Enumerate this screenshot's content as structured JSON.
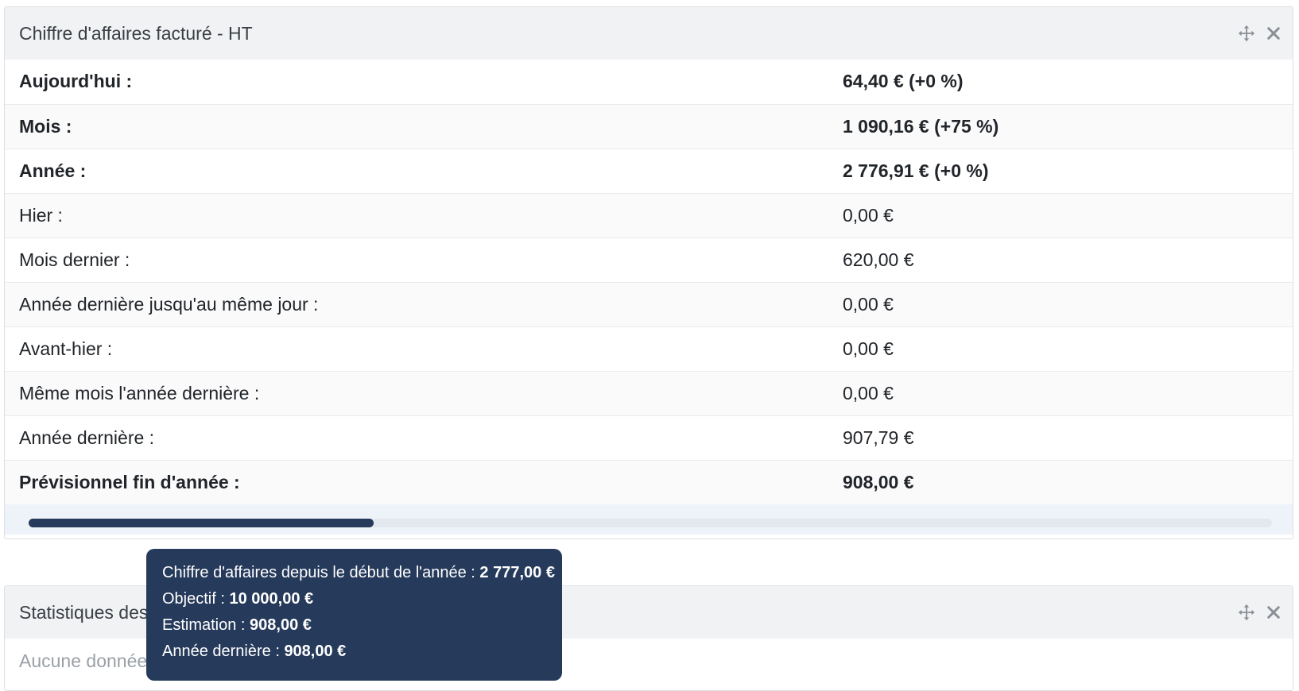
{
  "panel1": {
    "title": "Chiffre d'affaires facturé - HT",
    "tools": {
      "move_icon": "move-arrows-icon",
      "close_icon": "close-icon"
    },
    "rows": [
      {
        "label": "Aujourd'hui :",
        "value": "64,40 € (+0 %)",
        "bold": true
      },
      {
        "label": "Mois :",
        "value": "1 090,16 € (+75 %)",
        "bold": true
      },
      {
        "label": "Année :",
        "value": "2 776,91 € (+0 %)",
        "bold": true
      },
      {
        "label": "Hier :",
        "value": "0,00 €",
        "bold": false
      },
      {
        "label": "Mois dernier :",
        "value": "620,00 €",
        "bold": false
      },
      {
        "label": "Année dernière jusqu'au même jour :",
        "value": "0,00 €",
        "bold": false
      },
      {
        "label": "Avant-hier :",
        "value": "0,00 €",
        "bold": false
      },
      {
        "label": "Même mois l'année dernière :",
        "value": "0,00 €",
        "bold": false
      },
      {
        "label": "Année dernière :",
        "value": "907,79 €",
        "bold": false
      },
      {
        "label": "Prévisionnel fin d'année :",
        "value": "908,00 €",
        "bold": true
      }
    ],
    "progress": {
      "fraction": 0.2777,
      "color": "#263a5b"
    }
  },
  "panel2": {
    "title": "Statistiques des",
    "empty_text": "Aucune donnée"
  },
  "tooltip": {
    "lines": [
      {
        "label": "Chiffre d'affaires depuis le début de l'année : ",
        "value": "2 777,00 €"
      },
      {
        "label": "Objectif : ",
        "value": "10 000,00 €"
      },
      {
        "label": "Estimation : ",
        "value": "908,00 €"
      },
      {
        "label": "Année dernière : ",
        "value": "908,00 €"
      }
    ]
  },
  "colors": {
    "accent": "#263a5b",
    "header_bg": "#f1f2f4",
    "progress_bg": "#eef3fa"
  }
}
